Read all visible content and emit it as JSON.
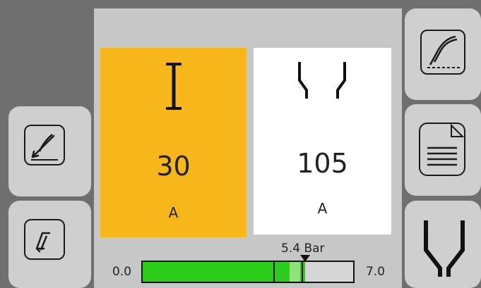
{
  "current_tile": {
    "icon": "current-i-icon",
    "value": "30",
    "unit": "A",
    "color": "#f7b71b"
  },
  "output_tile": {
    "icon": "electrode-gap-icon",
    "value": "105",
    "unit": "A",
    "color": "#ffffff"
  },
  "pressure": {
    "label": "5.4 Bar",
    "min": "0.0",
    "max": "7.0",
    "value": 5.4,
    "scale_max": 7.0
  },
  "left_buttons": [
    {
      "icon": "torch-edit-icon"
    },
    {
      "icon": "down-arrow-icon"
    }
  ],
  "right_buttons": [
    {
      "icon": "torch-gouge-icon"
    },
    {
      "icon": "document-icon"
    },
    {
      "icon": "electrode-funnel-icon"
    }
  ],
  "colors": {
    "accent": "#f7b71b",
    "bar_fill": "#2ccd1a",
    "bar_light": "#8fe37a",
    "panel": "#c7c7c7",
    "frame": "#6f6f6f"
  }
}
